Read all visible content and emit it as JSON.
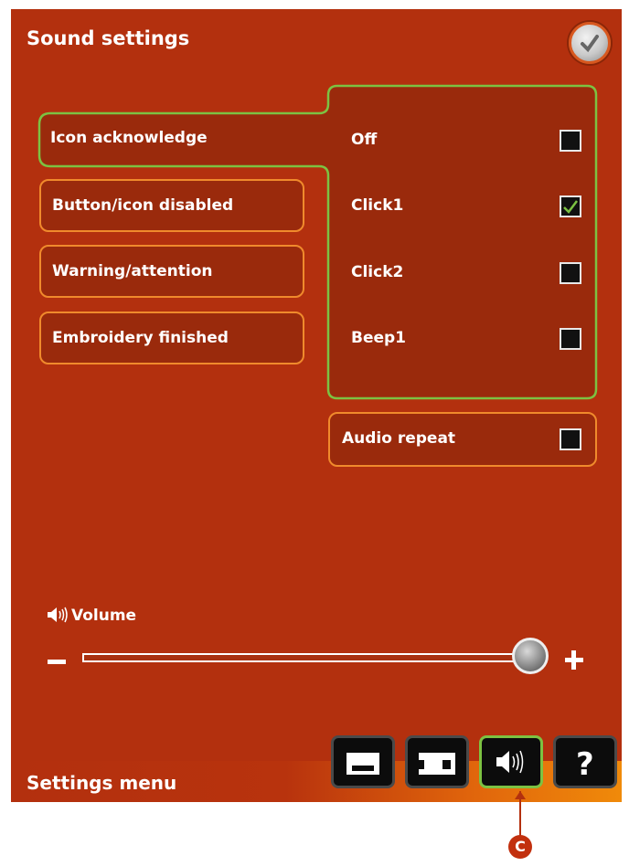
{
  "header": {
    "title": "Sound settings",
    "confirm_icon": "checkmark-icon"
  },
  "categories": [
    {
      "label": "Icon acknowledge",
      "selected": true
    },
    {
      "label": "Button/icon disabled",
      "selected": false
    },
    {
      "label": "Warning/attention",
      "selected": false
    },
    {
      "label": "Embroidery finished",
      "selected": false
    }
  ],
  "options": [
    {
      "label": "Off",
      "checked": false
    },
    {
      "label": "Click1",
      "checked": true
    },
    {
      "label": "Click2",
      "checked": false
    },
    {
      "label": "Beep1",
      "checked": false
    }
  ],
  "audio_repeat": {
    "label": "Audio repeat",
    "checked": false
  },
  "volume": {
    "label": "Volume",
    "minus": "–",
    "plus": "+",
    "level": 1.0
  },
  "footer": {
    "title": "Settings menu"
  },
  "toolbar": [
    {
      "icon": "sewing-machine-settings-icon",
      "active": false
    },
    {
      "icon": "embroidery-machine-settings-icon",
      "active": false
    },
    {
      "icon": "sound-settings-icon",
      "active": true
    },
    {
      "icon": "help-icon",
      "active": false
    }
  ],
  "callout": {
    "label": "C"
  },
  "colors": {
    "background": "#b3300e",
    "accent_green": "#7cc242",
    "accent_orange": "#f08a2c"
  }
}
